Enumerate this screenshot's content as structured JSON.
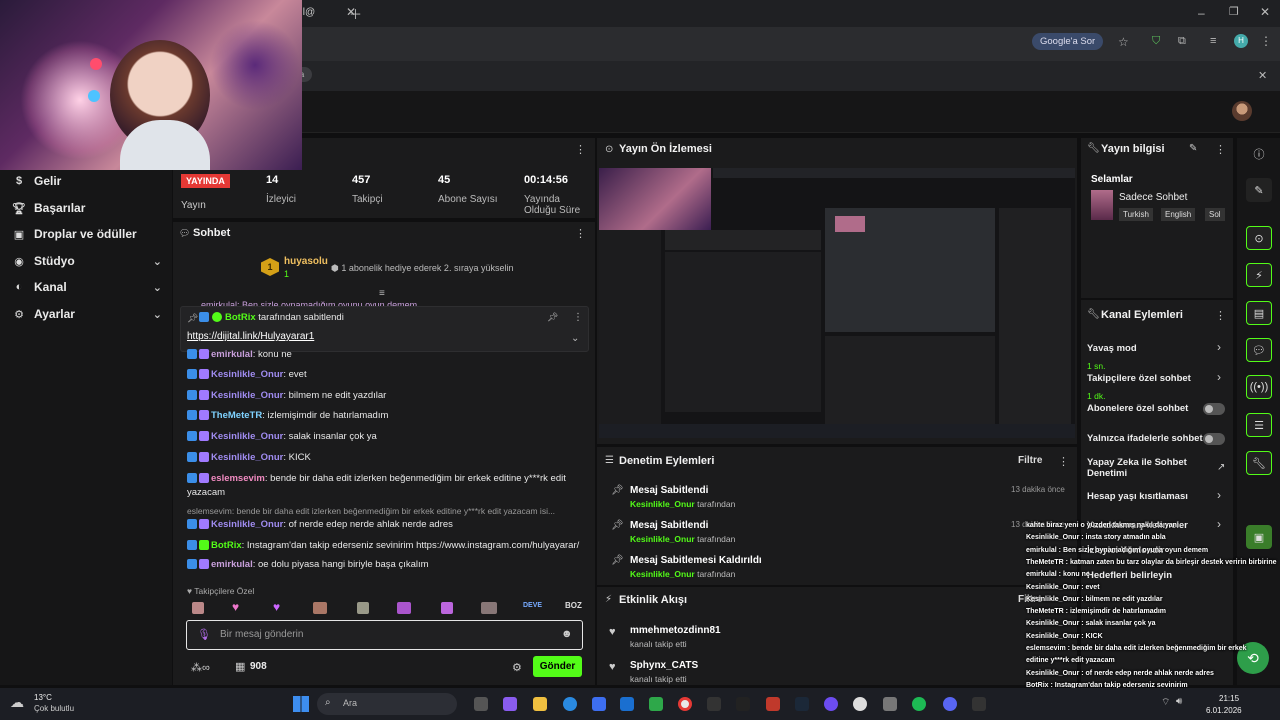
{
  "browser": {
    "tab_partial": "ıl@",
    "google_btn": "Google'a Sor",
    "infobar_partial": "la",
    "avatar_letter": "H"
  },
  "sidebar": {
    "items": [
      {
        "label": "Gelir",
        "icon": "dollar-icon"
      },
      {
        "label": "Başarılar",
        "icon": "trophy-icon"
      },
      {
        "label": "Droplar ve ödüller",
        "icon": "gift-icon"
      },
      {
        "label": "Stüdyo",
        "icon": "studio-icon"
      },
      {
        "label": "Kanal",
        "icon": "channel-icon"
      },
      {
        "label": "Ayarlar",
        "icon": "settings-icon"
      }
    ]
  },
  "stats": {
    "live_badge": "YAYINDA",
    "live_label": "Yayın",
    "viewers": "14",
    "viewers_label": "İzleyici",
    "followers": "457",
    "followers_label": "Takipçi",
    "subs": "45",
    "subs_label": "Abone Sayısı",
    "duration": "00:14:56",
    "duration_label": "Yayında Olduğu Süre"
  },
  "chat": {
    "title": "Sohbet",
    "gift_user": "huyasolu",
    "gift_count": "1",
    "gift_text": "1 abonelik hediye ederek 2. sıraya yükselin",
    "pinned_by": "BotRix",
    "pinned_suffix": " tarafından sabitlendi",
    "pinned_link": "https://dijital.link/Hulyayarar1",
    "cut_top": "emirkulal: Ben sizle oynamadığım oyunu oyun demem",
    "messages": [
      {
        "user": "emirkulal",
        "text": ": konu ne",
        "color": "#c9a0dc"
      },
      {
        "user": "Kesinlikle_Onur",
        "text": ": evet",
        "color": "#a08cf0"
      },
      {
        "user": "Kesinlikle_Onur",
        "text": ": bilmem ne edit yazdılar",
        "color": "#a08cf0"
      },
      {
        "user": "TheMeteTR",
        "text": ": izlemişimdir de hatırlamadım",
        "color": "#7fd2ff"
      },
      {
        "user": "Kesinlikle_Onur",
        "text": ": salak insanlar çok ya",
        "color": "#a08cf0"
      },
      {
        "user": "Kesinlikle_Onur",
        "text": ": KICK",
        "color": "#a08cf0"
      },
      {
        "user": "eslemsevim",
        "text": ": bende bir daha edit izlerken beğenmediğim bir erkek editine y***rk edit",
        "color": "#f08ac0"
      },
      {
        "user": "",
        "text": "yazacam",
        "color": "#e8e8e8"
      },
      {
        "user": "",
        "text": "eslemsevim: bende bir daha edit izlerken beğenmediğim bir erkek editine y***rk edit yazacam isi...",
        "color": "#9a9a9a"
      },
      {
        "user": "Kesinlikle_Onur",
        "text": ": of nerde edep nerde ahlak nerde adres",
        "color": "#a08cf0"
      },
      {
        "user": "BotRix",
        "text": ": Instagram'dan takip ederseniz sevinirim https://www.instagram.com/hulyayarar/",
        "color": "#53fc18"
      },
      {
        "user": "emirkulal",
        "text": ": oe dolu piyasa hangi biriyle başa çıkalım",
        "color": "#c9a0dc"
      }
    ],
    "followers_only": "Takipçilere Özel",
    "emotes": [
      "DEVE",
      "BOZ"
    ],
    "input_placeholder": "Bir mesaj gönderin",
    "points": "908",
    "send_label": "Gönder"
  },
  "preview": {
    "title": "Yayın Ön İzlemesi"
  },
  "moderation": {
    "title": "Denetim Eylemleri",
    "filter": "Filtre",
    "items": [
      {
        "action": "Mesaj Sabitlendi",
        "user": "Kesinlikle_Onur",
        "suffix": " tarafından",
        "time": "13 dakika önce"
      },
      {
        "action": "Mesaj Sabitlendi",
        "user": "Kesinlikle_Onur",
        "suffix": " tarafından",
        "time": "13 dakika önce"
      },
      {
        "action": "Mesaj Sabitlemesi Kaldırıldı",
        "user": "Kesinlikle_Onur",
        "suffix": " tarafından",
        "time": ""
      }
    ]
  },
  "activity": {
    "title": "Etkinlik Akışı",
    "filter": "Filtre",
    "items": [
      {
        "user": "mmehmetozdinn81",
        "text": "kanalı takip etti"
      },
      {
        "user": "Sphynx_CATS",
        "text": "kanalı takip etti"
      }
    ]
  },
  "stream_info": {
    "title": "Yayın bilgisi",
    "stream_title": "Selamlar",
    "category": "Sadece Sohbet",
    "tags": [
      "Turkish",
      "English",
      "Sol"
    ]
  },
  "channel_actions": {
    "title": "Kanal Eylemleri",
    "slow_mode": "Yavaş mod",
    "slow_mode_value": "1 sn.",
    "followers_chat": "Takipçilere özel sohbet",
    "followers_chat_value": "1 dk.",
    "subs_chat": "Abonelere özel sohbet",
    "emotes_chat": "Yalnızca ifadelerle sohbet",
    "ai_chat": "Yapay Zeka ile Sohbet Denetimi",
    "age_limit": "Hesap yaşı kısıtlaması",
    "banned_words": "Yasaklanmış kelimeler",
    "viewer_mgmt": "İzleyici Yönlendir",
    "targets": "Hedefleri belirleyin"
  },
  "overlay": {
    "lines": [
      "kahte biraz yeni o yüzden takmış nakıl da yani",
      "Kesinlikle_Onur : insta story atmadın abla",
      "emirkulal : Ben sizle oynamadığım oyuna oyun demem",
      "TheMeteTR : katman zaten bu tarz olaylar da birleşir destek veririn birbirine",
      "emirkulal : konu ne",
      "Kesinlikle_Onur : evet",
      "Kesinlikle_Onur : bilmem ne edit yazdılar",
      "TheMeteTR : izlemişimdir de hatırlamadım",
      "Kesinlikle_Onur : salak insanlar çok ya",
      "Kesinlikle_Onur : KICK",
      "eslemsevim : bende bir daha edit izlerken beğenmediğim bir erkek",
      "editine y***rk edit yazacam",
      "Kesinlikle_Onur : of nerde edep nerde ahlak nerde adres",
      "BotRix : Instagram'dan takip ederseniz sevinirim",
      "https://www.instagram.com/hulyayarar/",
      "emirkulal : oe dolu piyasa hangi biriyle başa çıkalım"
    ]
  },
  "taskbar": {
    "weather_temp": "13°C",
    "weather_desc": "Çok bulutlu",
    "search": "Ara",
    "time": "21:15",
    "date": "6.01.2026"
  }
}
